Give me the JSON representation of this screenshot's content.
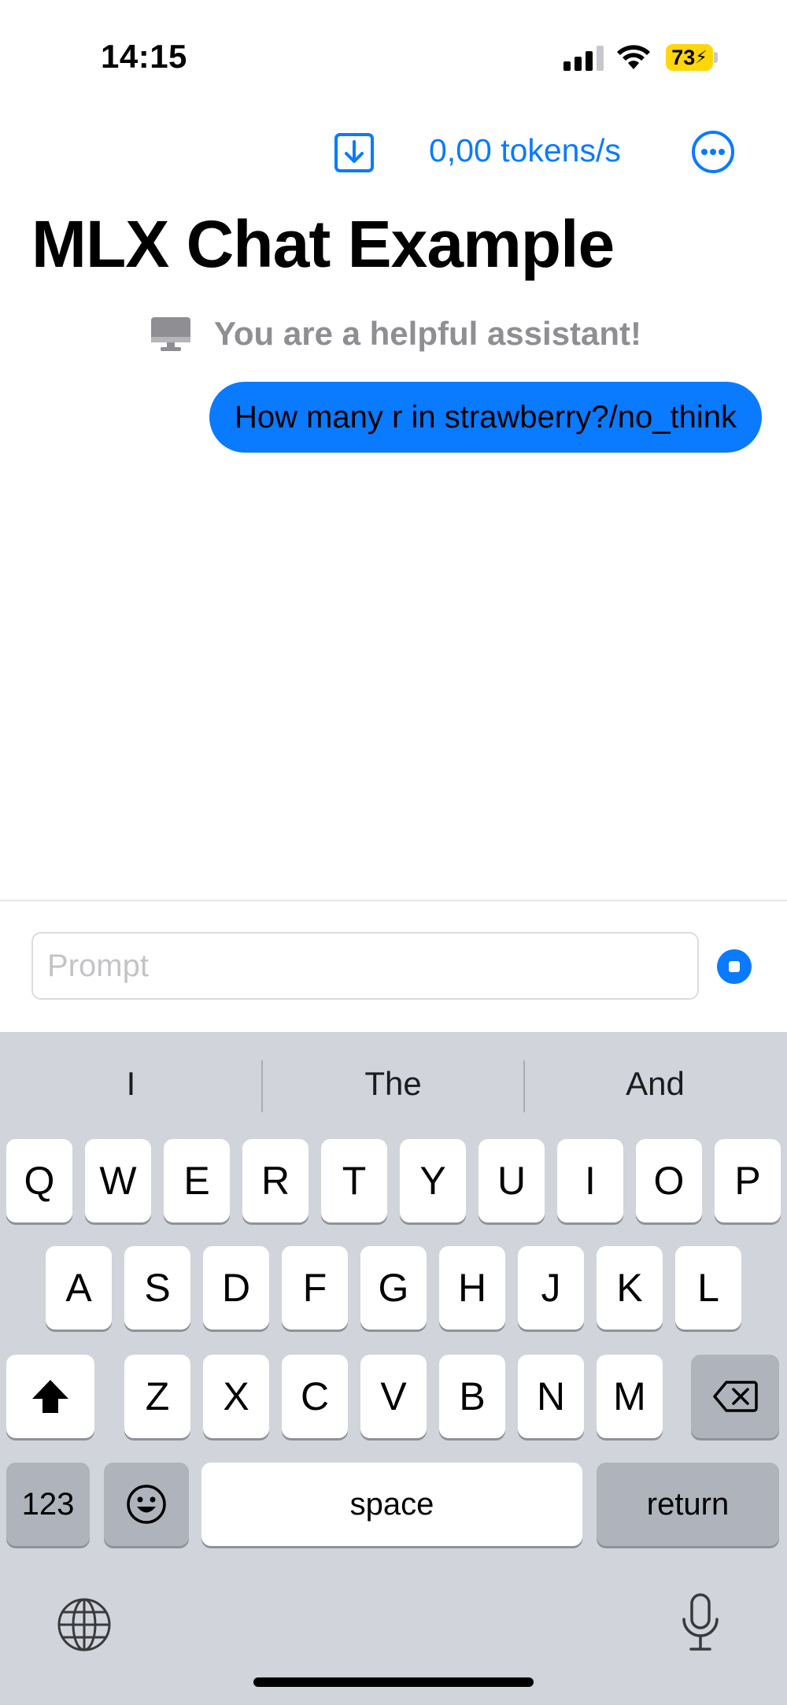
{
  "status_bar": {
    "time": "14:15",
    "battery": "73"
  },
  "toolbar": {
    "tokens_per_second": "0,00 tokens/s"
  },
  "page": {
    "title": "MLX Chat Example"
  },
  "messages": {
    "system": "You are a helpful assistant!",
    "user": "How many r in strawberry?/no_think"
  },
  "composer": {
    "placeholder": "Prompt",
    "value": ""
  },
  "keyboard": {
    "suggestions": [
      "I",
      "The",
      "And"
    ],
    "row1": [
      "Q",
      "W",
      "E",
      "R",
      "T",
      "Y",
      "U",
      "I",
      "O",
      "P"
    ],
    "row2": [
      "A",
      "S",
      "D",
      "F",
      "G",
      "H",
      "J",
      "K",
      "L"
    ],
    "row3": [
      "Z",
      "X",
      "C",
      "V",
      "B",
      "N",
      "M"
    ],
    "numbers_label": "123",
    "space_label": "space",
    "return_label": "return"
  },
  "colors": {
    "accent": "#0a7aff",
    "keyboard_bg": "#d1d4db",
    "battery": "#ffd60a"
  }
}
